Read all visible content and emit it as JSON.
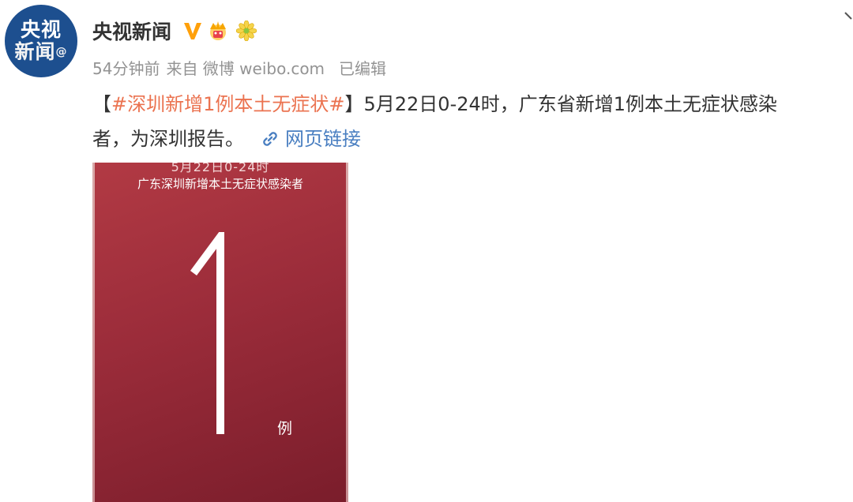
{
  "user": {
    "name": "央视新闻",
    "avatar_line1": "央视",
    "avatar_line2": "新闻",
    "avatar_at": "@"
  },
  "icons": {
    "verified": "verified-v-icon",
    "crown": "crown-member-icon",
    "flower": "flower-badge-icon",
    "link": "link-icon",
    "collapse": "chevron-icon"
  },
  "meta": {
    "time": "54分钟前",
    "source": "来自 微博 weibo.com",
    "edited": "已编辑"
  },
  "post": {
    "bracket_open": "【",
    "topic": "#深圳新增1例本土无症状#",
    "bracket_close": "】",
    "line1_rest": "5月22日0-24时，广东省新增1例本土无症状感染",
    "line2": "者，为深圳报告。",
    "link_label": "网页链接"
  },
  "image": {
    "date": "5月22日0-24时",
    "headline": "广东深圳新增本土无症状感染者",
    "count": "1",
    "unit": "例"
  },
  "colors": {
    "topic": "#eb7350",
    "link": "#4a7fc1",
    "verified": "#ffa00a",
    "image_bg": "#9b2c3a"
  }
}
